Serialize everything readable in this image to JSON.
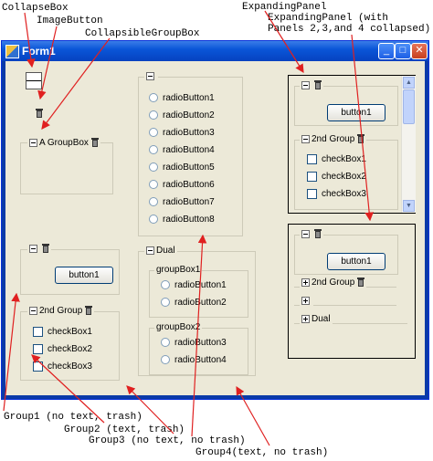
{
  "annotations": {
    "collapse_box": "CollapseBox",
    "image_button": "ImageButton",
    "collapsible_group_box": "CollapsibleGroupBox",
    "expanding_panel": "ExpandingPanel",
    "expanding_panel_collapsed_line1": "ExpandingPanel (with",
    "expanding_panel_collapsed_line2": "Panels 2,3,and 4 collapsed)",
    "group1": "Group1 (no text, trash)",
    "group2": "Group2 (text, trash)",
    "group3": "Group3 (no text, no trash)",
    "group4": "Group4(text, no trash)"
  },
  "window": {
    "title": "Form1",
    "minimize": "_",
    "maximize": "□",
    "close": "✕"
  },
  "a_groupbox": {
    "title": "A GroupBox"
  },
  "radio_group": {
    "items": [
      "radioButton1",
      "radioButton2",
      "radioButton3",
      "radioButton4",
      "radioButton5",
      "radioButton6",
      "radioButton7",
      "radioButton8"
    ]
  },
  "group1": {
    "button": "button1"
  },
  "group2": {
    "title": "2nd Group",
    "checks": [
      "checkBox1",
      "checkBox2",
      "checkBox3"
    ]
  },
  "dual": {
    "title": "Dual",
    "box1": {
      "title": "groupBox1",
      "radios": [
        "radioButton1",
        "radioButton2"
      ]
    },
    "box2": {
      "title": "groupBox2",
      "radios": [
        "radioButton3",
        "radioButton4"
      ]
    }
  },
  "expanding_panel": {
    "button": "button1",
    "group2_title": "2nd Group",
    "checks": [
      "checkBox1",
      "checkBox2",
      "checkBox3"
    ]
  },
  "expanding_panel_collapsed": {
    "button": "button1",
    "group2_title": "2nd Group",
    "group4_title": "Dual"
  },
  "icons": {
    "minus": "minus-icon",
    "plus": "plus-icon",
    "trash": "trash-icon",
    "app": "form-icon"
  }
}
